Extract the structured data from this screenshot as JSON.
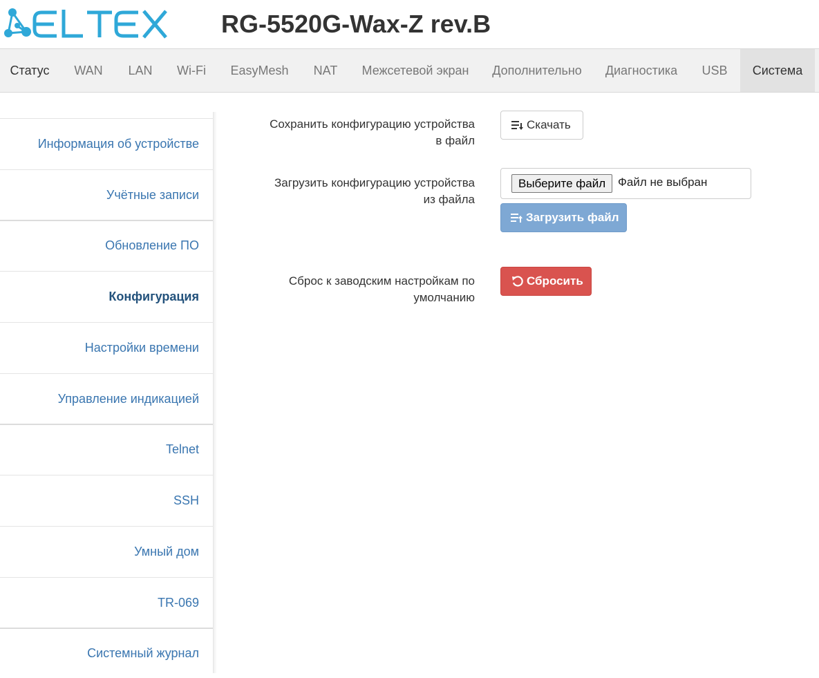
{
  "header": {
    "logo_text": "ELTEX",
    "model": "RG-5520G-Wax-Z rev.B"
  },
  "topnav": [
    {
      "label": "Статус"
    },
    {
      "label": "WAN"
    },
    {
      "label": "LAN"
    },
    {
      "label": "Wi-Fi"
    },
    {
      "label": "EasyMesh"
    },
    {
      "label": "NAT"
    },
    {
      "label": "Межсетевой экран"
    },
    {
      "label": "Дополнительно"
    },
    {
      "label": "Диагностика"
    },
    {
      "label": "USB"
    },
    {
      "label": "Система",
      "active": true
    }
  ],
  "sidebar": [
    {
      "label": "Информация об устройстве"
    },
    {
      "label": "Учётные записи"
    },
    {
      "label": "Обновление ПО"
    },
    {
      "label": "Конфигурация",
      "active": true
    },
    {
      "label": "Настройки времени"
    },
    {
      "label": "Управление индикацией"
    },
    {
      "label": "Telnet"
    },
    {
      "label": "SSH"
    },
    {
      "label": "Умный дом"
    },
    {
      "label": "TR-069"
    },
    {
      "label": "Системный журнал"
    }
  ],
  "config": {
    "save_label_line1": "Сохранить конфигурацию устройства",
    "save_label_line2": "в файл",
    "download_button": "Скачать",
    "load_label_line1": "Загрузить конфигурацию устройства",
    "load_label_line2": "из файла",
    "choose_file_button": "Выберите файл",
    "file_status": "Файл не выбран",
    "upload_button": "Загрузить файл",
    "reset_label_line1": "Сброс к заводским настройкам по",
    "reset_label_line2": "умолчанию",
    "reset_button": "Сбросить"
  },
  "colors": {
    "logo": "#2fa8d8",
    "link": "#3a76b0",
    "primary_disabled": "#7ea8d4",
    "danger": "#d9534f",
    "nav_bg": "#f1f1f1"
  },
  "icons": {
    "download": "list-download-icon",
    "upload": "list-upload-icon",
    "reset": "undo-icon"
  }
}
